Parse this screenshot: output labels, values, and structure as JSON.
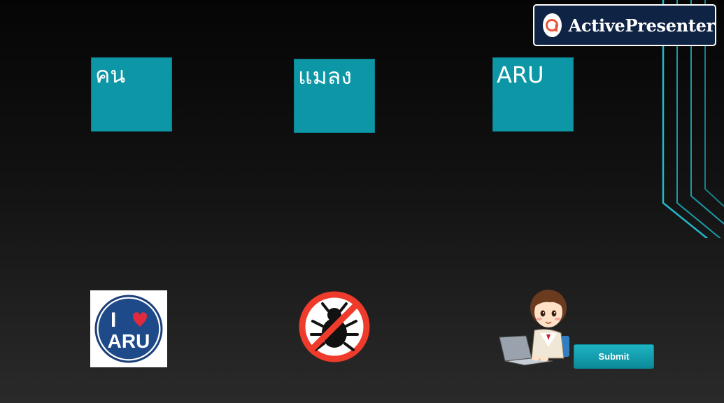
{
  "branding": {
    "name": "ActivePresenter",
    "logo_icon": "activepresenter-logo-icon",
    "background_color": "#0f2345",
    "accent_color": "#e8573a"
  },
  "targets": [
    {
      "label": "คน"
    },
    {
      "label": "แมลง"
    },
    {
      "label": "ARU"
    }
  ],
  "drag_items": [
    {
      "icon": "i-love-aru-logo-icon",
      "logo_text_top": "I",
      "logo_text_bottom": "ARU"
    },
    {
      "icon": "no-bug-icon"
    },
    {
      "icon": "woman-with-laptop-icon"
    }
  ],
  "submit": {
    "label": "Submit"
  },
  "colors": {
    "target_box": "#0d97a6",
    "submit_button": "#0b8a99",
    "deco_lines": "#22b8c8"
  }
}
